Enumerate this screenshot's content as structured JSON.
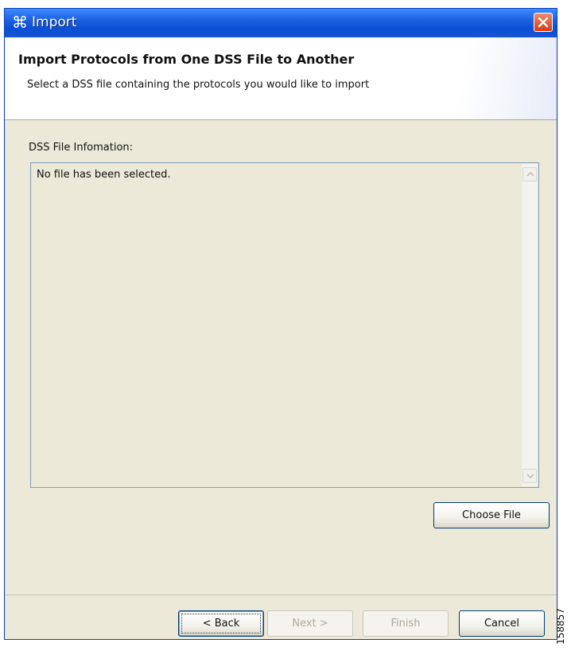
{
  "window": {
    "title": "Import",
    "title_icon": "cisco-sce-icon",
    "close_icon": "close-icon"
  },
  "banner": {
    "title": "Import Protocols from One DSS File to Another",
    "description": "Select a DSS file containing the protocols you would like to import"
  },
  "main": {
    "info_label": "DSS File Infomation:",
    "info_text": "No file has been selected.",
    "choose_file_label": "Choose File"
  },
  "footer": {
    "back_label": "< Back",
    "next_label": "Next >",
    "finish_label": "Finish",
    "cancel_label": "Cancel"
  },
  "side_id": "158857",
  "colors": {
    "titlebar": "#1d5fe0",
    "close": "#d43a12",
    "dialog_bg": "#ece9d8"
  }
}
